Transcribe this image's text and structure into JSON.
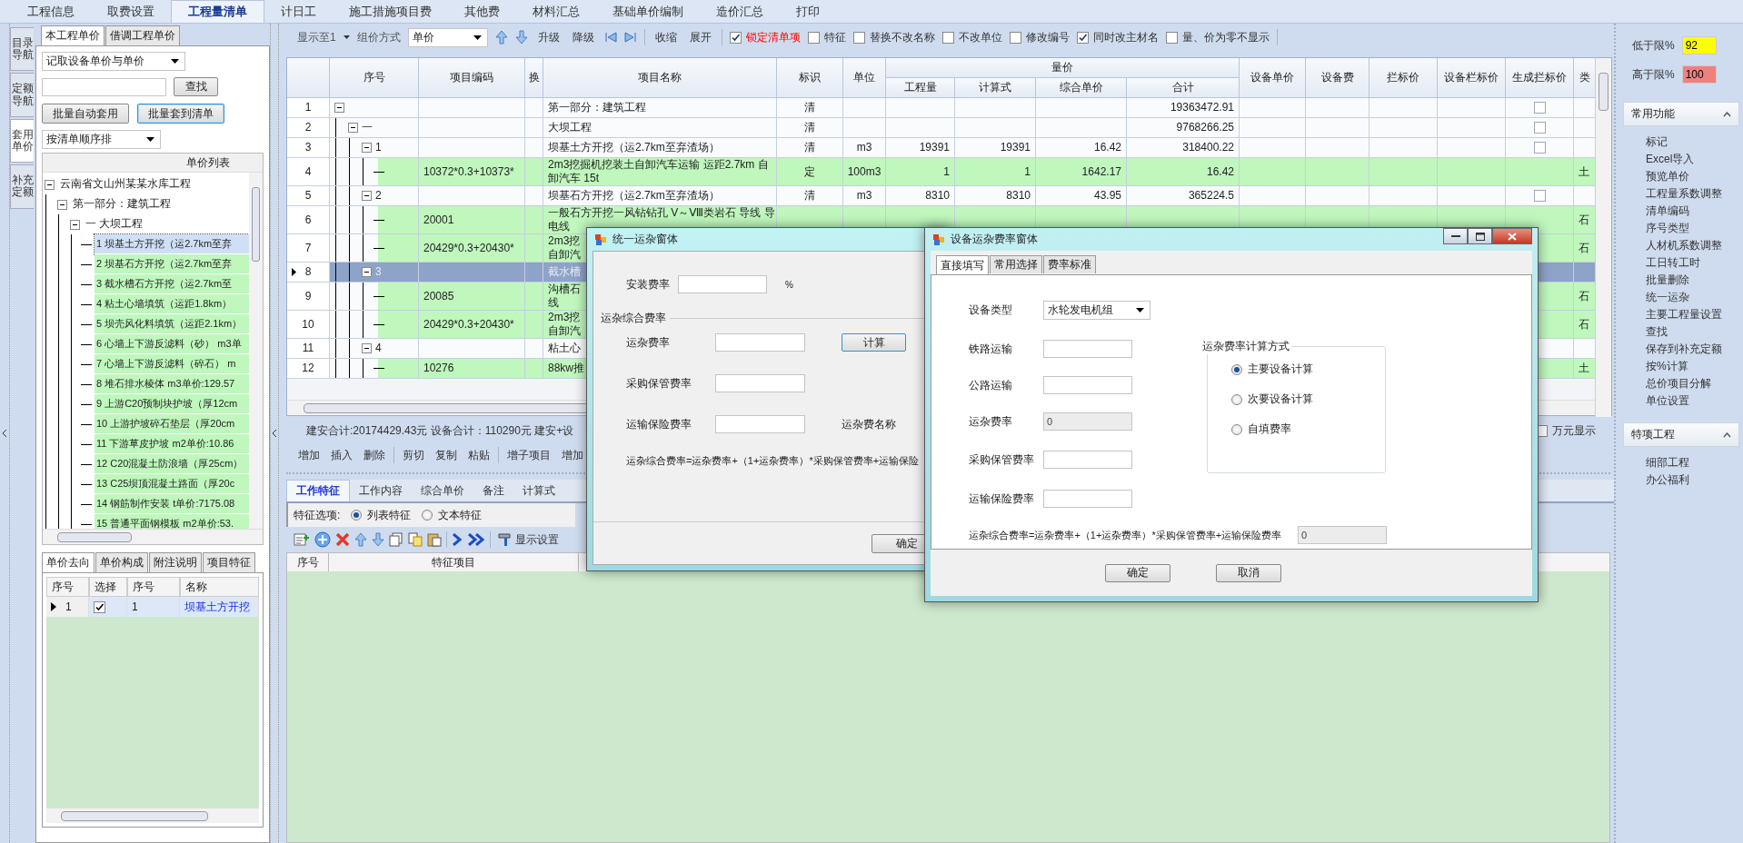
{
  "menu_tabs": [
    {
      "label": "工程信息",
      "selected": false
    },
    {
      "label": "取费设置",
      "selected": false
    },
    {
      "label": "工程量清单",
      "selected": true
    },
    {
      "label": "计日工",
      "selected": false
    },
    {
      "label": "施工措施项目费",
      "selected": false
    },
    {
      "label": "其他费",
      "selected": false
    },
    {
      "label": "材料汇总",
      "selected": false
    },
    {
      "label": "基础单价编制",
      "selected": false
    },
    {
      "label": "造价汇总",
      "selected": false
    },
    {
      "label": "打印",
      "selected": false
    }
  ],
  "side_tabs": [
    {
      "label": "目录导航",
      "selected": false
    },
    {
      "label": "定额导航",
      "selected": false
    },
    {
      "label": "套用单价",
      "selected": true
    },
    {
      "label": "补充定额",
      "selected": false
    }
  ],
  "left_panel": {
    "tabs": [
      {
        "label": "本工程单价",
        "selected": true
      },
      {
        "label": "借调工程单价",
        "selected": false
      }
    ],
    "price_mode": "记取设备单价与单价",
    "search_button": "查找",
    "buttons": [
      "批量自动套用",
      "批量套到清单"
    ],
    "sort": "按清单顺序排",
    "tree_title": "单价列表",
    "tree": [
      {
        "label": "云南省文山州某某水库工程",
        "expanded": true,
        "selected": false,
        "children": [
          {
            "label": "第一部分：建筑工程",
            "expanded": true,
            "selected": false,
            "children": [
              {
                "label": "一 大坝工程",
                "expanded": true,
                "selected": false,
                "children": [
                  {
                    "label": "1 坝基土方开挖（运2.7km至弃",
                    "selected": true
                  },
                  {
                    "label": "2 坝基石方开挖（运2.7km至弃",
                    "selected": false
                  },
                  {
                    "label": "3 截水槽石方开挖（运2.7km至",
                    "selected": false
                  },
                  {
                    "label": "4 粘土心墙填筑（运距1.8km）",
                    "selected": false
                  },
                  {
                    "label": "5 坝壳风化料填筑（运距2.1km）",
                    "selected": false
                  },
                  {
                    "label": "6 心墙上下游反滤料（砂） m3单",
                    "selected": false
                  },
                  {
                    "label": "7 心墙上下游反滤料（碎石） m",
                    "selected": false
                  },
                  {
                    "label": "8 堆石排水棱体 m3单价:129.57",
                    "selected": false
                  },
                  {
                    "label": "9 上游C20预制块护坡（厚12cm",
                    "selected": false
                  },
                  {
                    "label": "10 上游护坡碎石垫层（厚20cm",
                    "selected": false
                  },
                  {
                    "label": "11 下游草皮护坡 m2单价:10.86",
                    "selected": false
                  },
                  {
                    "label": "12 C20混凝土防浪墙（厚25cm）",
                    "selected": false
                  },
                  {
                    "label": "13 C25坝顶混凝土路面（厚20c",
                    "selected": false
                  },
                  {
                    "label": "14 钢筋制作安装 t单价:7175.08",
                    "selected": false
                  },
                  {
                    "label": "15 普通平面钢模板 m2单价:53.",
                    "selected": false
                  }
                ]
              }
            ]
          }
        ]
      }
    ],
    "bottom_tabs": [
      {
        "label": "单价去向",
        "selected": true
      },
      {
        "label": "单价构成",
        "selected": false
      },
      {
        "label": "附注说明",
        "selected": false
      },
      {
        "label": "项目特征",
        "selected": false
      }
    ],
    "usage_grid": {
      "columns": [
        "序号",
        "选择",
        "序号",
        "名称"
      ],
      "rows": [
        {
          "num": "1",
          "checked": true,
          "seq": "1",
          "name": "坝基土方开挖",
          "selected": true
        }
      ]
    }
  },
  "toolbar": {
    "show_to": "显示至1",
    "group_label": "组价方式",
    "group_value": "单价",
    "level_buttons": [
      "升级",
      "降级"
    ],
    "fold_buttons": [
      "收缩",
      "展开"
    ],
    "options": [
      {
        "label": "锁定清单项",
        "checked": true,
        "alert": true
      },
      {
        "label": "特征",
        "checked": false,
        "alert": false
      },
      {
        "label": "替换不改名称",
        "checked": false,
        "alert": false
      },
      {
        "label": "不改单位",
        "checked": false,
        "alert": false
      },
      {
        "label": "修改编号",
        "checked": false,
        "alert": false
      },
      {
        "label": "同时改主材名",
        "checked": true,
        "alert": false
      },
      {
        "label": "量、价为零不显示",
        "checked": false,
        "alert": false
      }
    ]
  },
  "table": {
    "columns": [
      "序号",
      "项目编码",
      "换",
      "项目名称",
      "标识",
      "单位"
    ],
    "group": {
      "label": "量价",
      "columns": [
        "工程量",
        "计算式",
        "综合单价",
        "合计"
      ]
    },
    "columns_after": [
      "设备单价",
      "设备费",
      "拦标价",
      "设备栏标价",
      "生成拦标价",
      "类"
    ],
    "rows": [
      {
        "num": "1",
        "kind": "bill",
        "selected": false,
        "expanded": true,
        "name": [
          "第一部分：建筑工程"
        ],
        "mark": "清",
        "total": "19363472.91",
        "gen_check": false,
        "children": [
          {
            "num": "2",
            "kind": "bill",
            "selected": false,
            "expanded": true,
            "seq": "一",
            "name": [
              "大坝工程"
            ],
            "mark": "清",
            "total": "9768266.25",
            "gen_check": false,
            "children": [
              {
                "num": "3",
                "kind": "bill",
                "selected": false,
                "expanded": true,
                "seq": "1",
                "name": [
                  "坝基土方开挖（运2.7km至弃渣场）"
                ],
                "mark": "清",
                "unit": "m3",
                "qty": "19391",
                "formula": "19391",
                "price": "16.42",
                "total": "318400.22",
                "gen_check": false,
                "children": [
                  {
                    "num": "4",
                    "kind": "quota",
                    "selected": false,
                    "code": "10372*0.3+10373*",
                    "name": [
                      "2m3挖掘机挖装土自卸汽车运输 运距2.7km 自",
                      "卸汽车 15t"
                    ],
                    "mark": "定",
                    "unit": "100m3",
                    "qty": "1",
                    "formula": "1",
                    "price": "1642.17",
                    "total": "16.42",
                    "cls": "土"
                  }
                ]
              },
              {
                "num": "5",
                "kind": "bill",
                "selected": false,
                "expanded": true,
                "seq": "2",
                "name": [
                  "坝基石方开挖（运2.7km至弃渣场）"
                ],
                "mark": "清",
                "unit": "m3",
                "qty": "8310",
                "formula": "8310",
                "price": "43.95",
                "total": "365224.5",
                "gen_check": false,
                "children": [
                  {
                    "num": "6",
                    "kind": "quota",
                    "selected": false,
                    "code": "20001",
                    "name": [
                      "一般石方开挖一风钻钻孔 V～Ⅷ类岩石 导线 导",
                      "电线"
                    ],
                    "cls": "石"
                  },
                  {
                    "num": "7",
                    "kind": "quota",
                    "selected": false,
                    "code": "20429*0.3+20430*",
                    "name": [
                      "2m3挖",
                      "自卸汽"
                    ],
                    "cls": "石"
                  }
                ]
              },
              {
                "num": "8",
                "kind": "bill",
                "selected": true,
                "expanded": true,
                "seq": "3",
                "name": [
                  "截水槽"
                ],
                "children": [
                  {
                    "num": "9",
                    "kind": "quota",
                    "selected": false,
                    "code": "20085",
                    "name": [
                      "沟槽石",
                      "线"
                    ],
                    "cls": "石"
                  },
                  {
                    "num": "10",
                    "kind": "quota",
                    "selected": false,
                    "code": "20429*0.3+20430*",
                    "name": [
                      "2m3挖",
                      "自卸汽"
                    ],
                    "cls": "石"
                  }
                ]
              },
              {
                "num": "11",
                "kind": "bill",
                "selected": false,
                "expanded": true,
                "seq": "4",
                "name": [
                  "粘土心"
                ],
                "children": [
                  {
                    "num": "12",
                    "kind": "quota",
                    "selected": false,
                    "code": "10276",
                    "name": [
                      "88kw推"
                    ],
                    "cls": "土"
                  }
                ]
              }
            ]
          }
        ]
      }
    ]
  },
  "summary": "建安合计:20174429.43元 设备合计：110290元 建安+设",
  "wan_yuan": {
    "label": "万元显示",
    "checked": false
  },
  "edit_groups": [
    [
      "增加",
      "插入",
      "删除"
    ],
    [
      "剪切",
      "复制",
      "粘贴"
    ],
    [
      "增子项目",
      "增加"
    ]
  ],
  "detail_tabs": [
    {
      "label": "工作特征",
      "selected": true
    },
    {
      "label": "工作内容",
      "selected": false
    },
    {
      "label": "综合单价",
      "selected": false
    },
    {
      "label": "备注",
      "selected": false
    },
    {
      "label": "计算式",
      "selected": false
    }
  ],
  "feature_options": {
    "label": "特征选项:",
    "options": [
      {
        "label": "列表特征",
        "selected": true
      },
      {
        "label": "文本特征",
        "selected": false
      }
    ]
  },
  "display_settings": "显示设置",
  "feature_columns": [
    "序号",
    "特征项目"
  ],
  "right_panel": {
    "low_limit": {
      "label": "低于限%",
      "value": "92"
    },
    "high_limit": {
      "label": "高于限%",
      "value": "100"
    },
    "sections": [
      {
        "title": "常用功能",
        "expanded": true,
        "items": [
          "标记",
          "Excel导入",
          "预览单价",
          "工程量系数调整",
          "清单编码",
          "序号类型",
          "人材机系数调整",
          "工日转工时",
          "批量删除",
          "统一运杂",
          "主要工程量设置",
          "查找",
          "保存到补充定额",
          "按%计算",
          "总价项目分解",
          "单位设置"
        ]
      },
      {
        "title": "特项工程",
        "expanded": true,
        "items": [
          "细部工程",
          "办公福利"
        ]
      }
    ]
  },
  "dialog_freight": {
    "title": "统一运杂窗体",
    "install_rate": {
      "label": "安装费率",
      "unit": "%"
    },
    "group": "运杂综合费率",
    "fields": [
      "运杂费率",
      "采购保管费率",
      "运输保险费率"
    ],
    "calc_button": "计算",
    "name_label": "运杂费名称",
    "formula": "运杂综合费率=运杂费率+（1+运杂费率）*采购保管费率+运输保险",
    "ok": "确定"
  },
  "dialog_equipment": {
    "title": "设备运杂费率窗体",
    "tabs": [
      {
        "label": "直接填写",
        "selected": true
      },
      {
        "label": "常用选择",
        "selected": false
      },
      {
        "label": "费率标准",
        "selected": false
      }
    ],
    "device_type": {
      "label": "设备类型",
      "value": "水轮发电机组"
    },
    "fields": [
      {
        "label": "铁路运输",
        "disabled": false
      },
      {
        "label": "公路运输",
        "disabled": false
      },
      {
        "label": "运杂费率",
        "value": "0",
        "disabled": true
      },
      {
        "label": "采购保管费率",
        "disabled": false
      },
      {
        "label": "运输保险费率",
        "disabled": false
      }
    ],
    "method": {
      "title": "运杂费率计算方式",
      "options": [
        {
          "label": "主要设备计算",
          "selected": true
        },
        {
          "label": "次要设备计算",
          "selected": false
        },
        {
          "label": "自填费率",
          "selected": false
        }
      ]
    },
    "formula": {
      "label": "运杂综合费率=运杂费率+（1+运杂费率）*采购保管费率+运输保险费率",
      "value": "0"
    },
    "buttons": [
      "确定",
      "取消"
    ]
  }
}
